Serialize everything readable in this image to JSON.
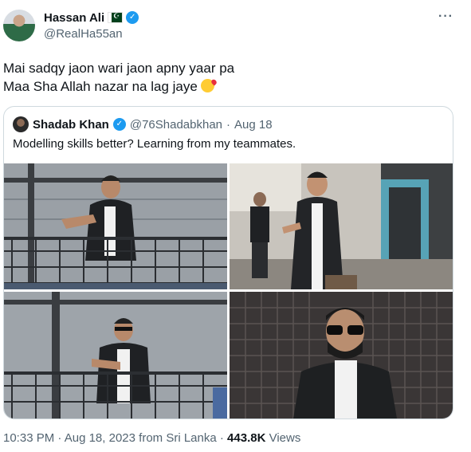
{
  "author": {
    "name": "Hassan Ali",
    "handle": "@RealHa55an",
    "flag": "pakistan-flag",
    "verified_icon": "verified-badge-icon"
  },
  "tweet": {
    "line1": "Mai sadqy jaon wari jaon apny yaar pa",
    "line2": "Maa Sha Allah nazar na lag jaye",
    "emoji": "face-blowing-kiss"
  },
  "quoted": {
    "name": "Shadab Khan",
    "handle": "@76Shadabkhan",
    "separator": "·",
    "date": "Aug 18",
    "text": "Modelling skills better? Learning from my teammates.",
    "photos": [
      "balcony-photo-1",
      "street-photo",
      "balcony-photo-2",
      "sunglasses-photo"
    ]
  },
  "meta": {
    "time": "10:33 PM",
    "sep1": "·",
    "date": "Aug 18, 2023",
    "location": "from Sri Lanka",
    "sep2": "·",
    "views_count": "443.8K",
    "views_label": "Views"
  },
  "colors": {
    "accent": "#1d9bf0",
    "text": "#0f1419",
    "muted": "#536471",
    "border": "#cfd9de"
  }
}
